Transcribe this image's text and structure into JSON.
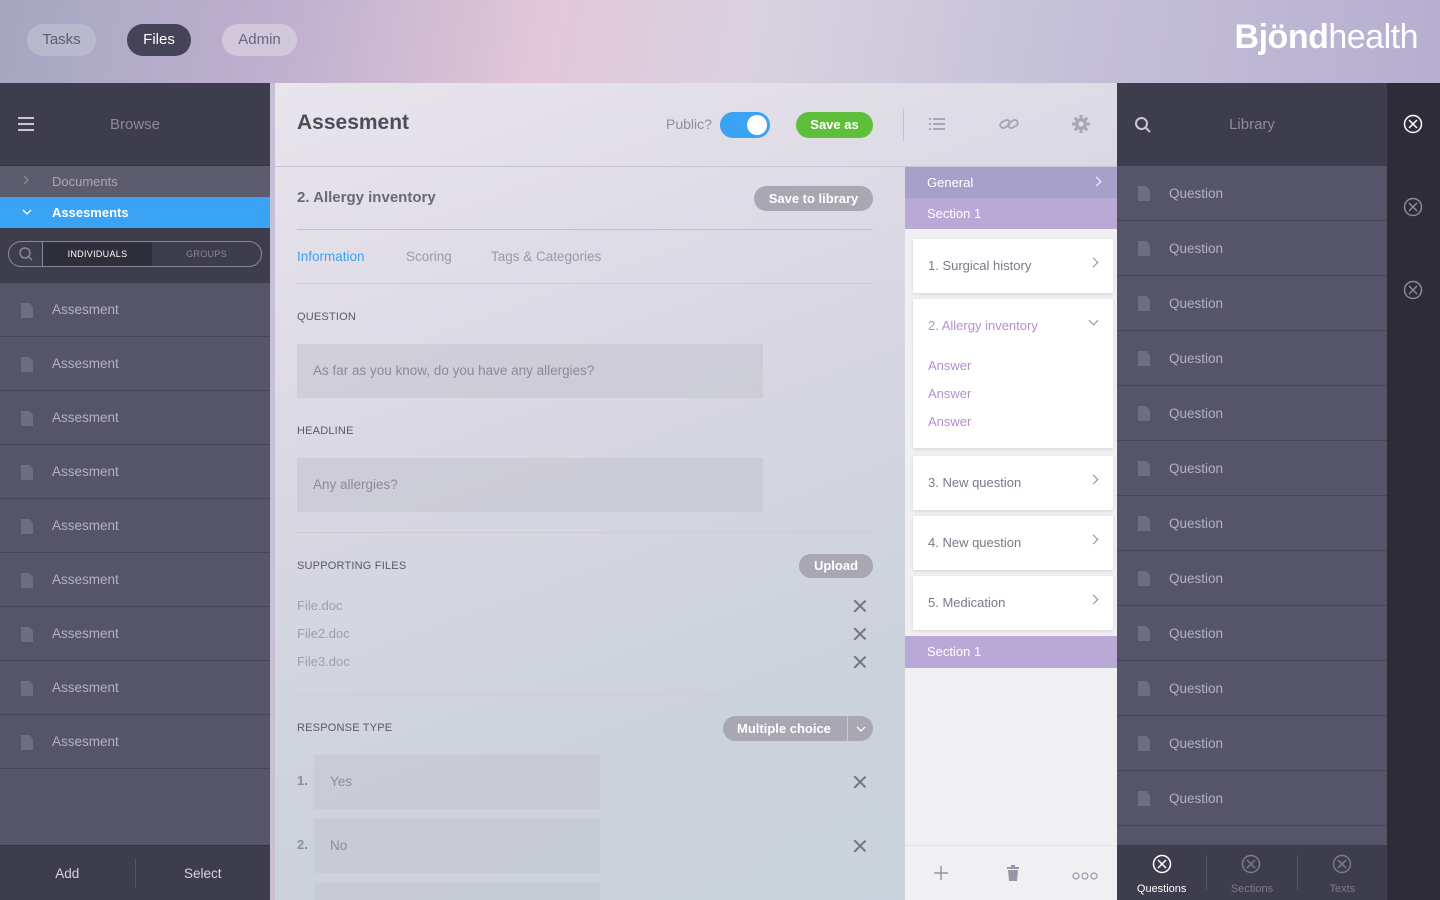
{
  "nav": {
    "tasks": "Tasks",
    "files": "Files",
    "admin": "Admin"
  },
  "logo": {
    "bold": "Bjönd",
    "light": "health"
  },
  "browse": {
    "title": "Browse",
    "tree": [
      {
        "label": "Documents"
      },
      {
        "label": "Assesments"
      }
    ],
    "segments": [
      "INDIVIDUALS",
      "GROUPS"
    ],
    "items": [
      "Assesment",
      "Assesment",
      "Assesment",
      "Assesment",
      "Assesment",
      "Assesment",
      "Assesment",
      "Assesment",
      "Assesment"
    ],
    "footer": {
      "add": "Add",
      "select": "Select"
    }
  },
  "editor": {
    "title": "Assesment",
    "public_label": "Public?",
    "public_on": true,
    "save_as": "Save as",
    "question_title": "2. Allergy inventory",
    "save_to_library": "Save to library",
    "tabs": [
      "Information",
      "Scoring",
      "Tags & Categories"
    ],
    "active_tab": "Information",
    "question_label": "QUESTION",
    "question_value": "As far as you know, do you have any allergies?",
    "headline_label": "HEADLINE",
    "headline_value": "Any allergies?",
    "files_label": "SUPPORTING FILES",
    "upload": "Upload",
    "files": [
      "File.doc",
      "File2.doc",
      "File3.doc"
    ],
    "response_label": "RESPONSE TYPE",
    "response_type": "Multiple choice",
    "responses": [
      {
        "num": "1.",
        "value": "Yes"
      },
      {
        "num": "2.",
        "value": "No"
      }
    ]
  },
  "sections": {
    "general": "General",
    "section1": "Section 1",
    "questions": [
      {
        "label": "1. Surgical history"
      },
      {
        "label": "2. Allergy inventory",
        "answers": [
          "Answer",
          "Answer",
          "Answer"
        ]
      },
      {
        "label": "3. New question"
      },
      {
        "label": "4. New question"
      },
      {
        "label": "5. Medication"
      }
    ],
    "section2": "Section 1"
  },
  "library": {
    "title": "Library",
    "items": [
      "Question",
      "Question",
      "Question",
      "Question",
      "Question",
      "Question",
      "Question",
      "Question",
      "Question",
      "Question",
      "Question",
      "Question"
    ],
    "footer": [
      "Questions",
      "Sections",
      "Texts"
    ]
  },
  "colors": {
    "accent": "#3ba3f4",
    "save_green": "#5ec03a",
    "section_purple": "#b9a9d6",
    "answer_purple": "#b58fd6"
  }
}
